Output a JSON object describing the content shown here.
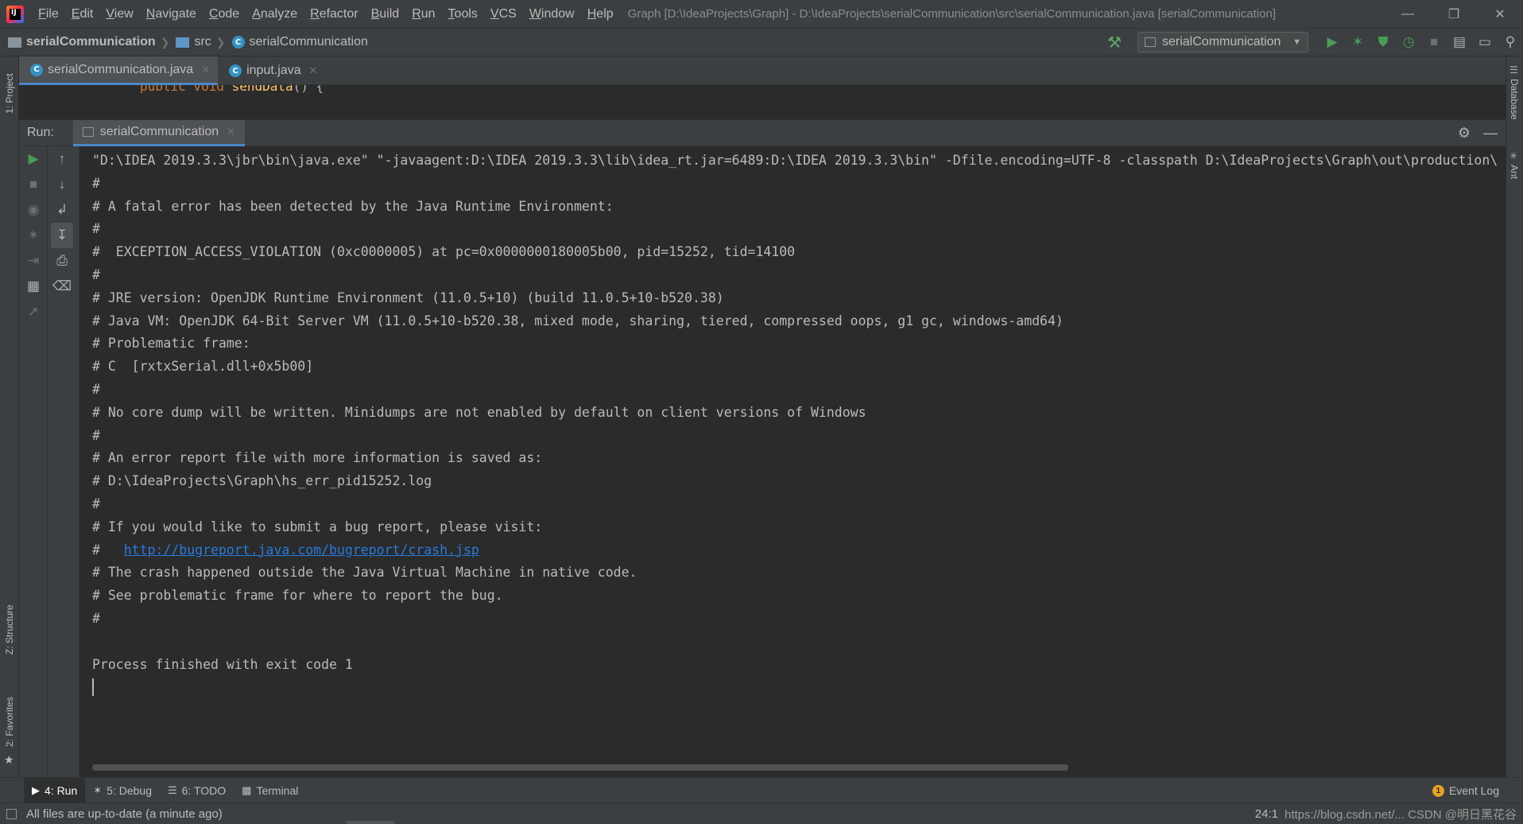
{
  "menu": [
    "File",
    "Edit",
    "View",
    "Navigate",
    "Code",
    "Analyze",
    "Refactor",
    "Build",
    "Run",
    "Tools",
    "VCS",
    "Window",
    "Help"
  ],
  "window_title": "Graph [D:\\IdeaProjects\\Graph] - D:\\IdeaProjects\\serialCommunication\\src\\serialCommunication.java [serialCommunication]",
  "breadcrumbs": {
    "project": "serialCommunication",
    "folder": "src",
    "file": "serialCommunication"
  },
  "run_config": "serialCommunication",
  "left_strip": {
    "project": "1: Project",
    "structure": "Z: Structure",
    "favorites": "2: Favorites"
  },
  "right_strip": {
    "database": "Database",
    "ant": "Ant"
  },
  "editor_tabs": [
    {
      "label": "serialCommunication.java",
      "active": true
    },
    {
      "label": "input.java",
      "active": false
    }
  ],
  "editor_peek": {
    "keyword": "public void ",
    "method": "sendData",
    "rest": "() {"
  },
  "run_panel": {
    "title": "Run:",
    "tab": "serialCommunication"
  },
  "console": {
    "lines": [
      "\"D:\\IDEA 2019.3.3\\jbr\\bin\\java.exe\" \"-javaagent:D:\\IDEA 2019.3.3\\lib\\idea_rt.jar=6489:D:\\IDEA 2019.3.3\\bin\" -Dfile.encoding=UTF-8 -classpath D:\\IdeaProjects\\Graph\\out\\production\\",
      "#",
      "# A fatal error has been detected by the Java Runtime Environment:",
      "#",
      "#  EXCEPTION_ACCESS_VIOLATION (0xc0000005) at pc=0x0000000180005b00, pid=15252, tid=14100",
      "#",
      "# JRE version: OpenJDK Runtime Environment (11.0.5+10) (build 11.0.5+10-b520.38)",
      "# Java VM: OpenJDK 64-Bit Server VM (11.0.5+10-b520.38, mixed mode, sharing, tiered, compressed oops, g1 gc, windows-amd64)",
      "# Problematic frame:",
      "# C  [rxtxSerial.dll+0x5b00]",
      "#",
      "# No core dump will be written. Minidumps are not enabled by default on client versions of Windows",
      "#",
      "# An error report file with more information is saved as:",
      "# D:\\IdeaProjects\\Graph\\hs_err_pid15252.log",
      "#",
      "# If you would like to submit a bug report, please visit:"
    ],
    "link_prefix": "#   ",
    "link": "http://bugreport.java.com/bugreport/crash.jsp",
    "lines_after": [
      "# The crash happened outside the Java Virtual Machine in native code.",
      "# See problematic frame for where to report the bug.",
      "#",
      "",
      "Process finished with exit code 1"
    ]
  },
  "toolwindows": [
    {
      "label": "4: Run",
      "icon": "play-icon",
      "active": true
    },
    {
      "label": "5: Debug",
      "icon": "bug-icon",
      "active": false
    },
    {
      "label": "6: TODO",
      "icon": "list-icon",
      "active": false
    },
    {
      "label": "Terminal",
      "icon": "terminal-icon",
      "active": false
    }
  ],
  "event_log": {
    "badge": "1",
    "label": "Event Log"
  },
  "status": {
    "message": "All files are up-to-date (a minute ago)",
    "position": "24:1",
    "watermark": "https://blog.csdn.net/...  CSDN @明日黑花谷"
  },
  "colors": {
    "link": "#287bde",
    "accent_tab": "#4a88c7",
    "run_green": "#499c54"
  }
}
